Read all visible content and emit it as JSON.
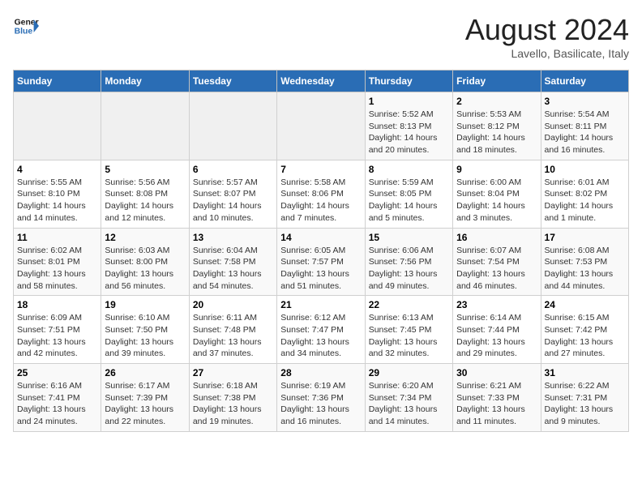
{
  "logo": {
    "text_general": "General",
    "text_blue": "Blue"
  },
  "title": "August 2024",
  "location": "Lavello, Basilicate, Italy",
  "days": [
    "Sunday",
    "Monday",
    "Tuesday",
    "Wednesday",
    "Thursday",
    "Friday",
    "Saturday"
  ],
  "weeks": [
    [
      {
        "day": "",
        "info": ""
      },
      {
        "day": "",
        "info": ""
      },
      {
        "day": "",
        "info": ""
      },
      {
        "day": "",
        "info": ""
      },
      {
        "day": "1",
        "info": "Sunrise: 5:52 AM\nSunset: 8:13 PM\nDaylight: 14 hours and 20 minutes."
      },
      {
        "day": "2",
        "info": "Sunrise: 5:53 AM\nSunset: 8:12 PM\nDaylight: 14 hours and 18 minutes."
      },
      {
        "day": "3",
        "info": "Sunrise: 5:54 AM\nSunset: 8:11 PM\nDaylight: 14 hours and 16 minutes."
      }
    ],
    [
      {
        "day": "4",
        "info": "Sunrise: 5:55 AM\nSunset: 8:10 PM\nDaylight: 14 hours and 14 minutes."
      },
      {
        "day": "5",
        "info": "Sunrise: 5:56 AM\nSunset: 8:08 PM\nDaylight: 14 hours and 12 minutes."
      },
      {
        "day": "6",
        "info": "Sunrise: 5:57 AM\nSunset: 8:07 PM\nDaylight: 14 hours and 10 minutes."
      },
      {
        "day": "7",
        "info": "Sunrise: 5:58 AM\nSunset: 8:06 PM\nDaylight: 14 hours and 7 minutes."
      },
      {
        "day": "8",
        "info": "Sunrise: 5:59 AM\nSunset: 8:05 PM\nDaylight: 14 hours and 5 minutes."
      },
      {
        "day": "9",
        "info": "Sunrise: 6:00 AM\nSunset: 8:04 PM\nDaylight: 14 hours and 3 minutes."
      },
      {
        "day": "10",
        "info": "Sunrise: 6:01 AM\nSunset: 8:02 PM\nDaylight: 14 hours and 1 minute."
      }
    ],
    [
      {
        "day": "11",
        "info": "Sunrise: 6:02 AM\nSunset: 8:01 PM\nDaylight: 13 hours and 58 minutes."
      },
      {
        "day": "12",
        "info": "Sunrise: 6:03 AM\nSunset: 8:00 PM\nDaylight: 13 hours and 56 minutes."
      },
      {
        "day": "13",
        "info": "Sunrise: 6:04 AM\nSunset: 7:58 PM\nDaylight: 13 hours and 54 minutes."
      },
      {
        "day": "14",
        "info": "Sunrise: 6:05 AM\nSunset: 7:57 PM\nDaylight: 13 hours and 51 minutes."
      },
      {
        "day": "15",
        "info": "Sunrise: 6:06 AM\nSunset: 7:56 PM\nDaylight: 13 hours and 49 minutes."
      },
      {
        "day": "16",
        "info": "Sunrise: 6:07 AM\nSunset: 7:54 PM\nDaylight: 13 hours and 46 minutes."
      },
      {
        "day": "17",
        "info": "Sunrise: 6:08 AM\nSunset: 7:53 PM\nDaylight: 13 hours and 44 minutes."
      }
    ],
    [
      {
        "day": "18",
        "info": "Sunrise: 6:09 AM\nSunset: 7:51 PM\nDaylight: 13 hours and 42 minutes."
      },
      {
        "day": "19",
        "info": "Sunrise: 6:10 AM\nSunset: 7:50 PM\nDaylight: 13 hours and 39 minutes."
      },
      {
        "day": "20",
        "info": "Sunrise: 6:11 AM\nSunset: 7:48 PM\nDaylight: 13 hours and 37 minutes."
      },
      {
        "day": "21",
        "info": "Sunrise: 6:12 AM\nSunset: 7:47 PM\nDaylight: 13 hours and 34 minutes."
      },
      {
        "day": "22",
        "info": "Sunrise: 6:13 AM\nSunset: 7:45 PM\nDaylight: 13 hours and 32 minutes."
      },
      {
        "day": "23",
        "info": "Sunrise: 6:14 AM\nSunset: 7:44 PM\nDaylight: 13 hours and 29 minutes."
      },
      {
        "day": "24",
        "info": "Sunrise: 6:15 AM\nSunset: 7:42 PM\nDaylight: 13 hours and 27 minutes."
      }
    ],
    [
      {
        "day": "25",
        "info": "Sunrise: 6:16 AM\nSunset: 7:41 PM\nDaylight: 13 hours and 24 minutes."
      },
      {
        "day": "26",
        "info": "Sunrise: 6:17 AM\nSunset: 7:39 PM\nDaylight: 13 hours and 22 minutes."
      },
      {
        "day": "27",
        "info": "Sunrise: 6:18 AM\nSunset: 7:38 PM\nDaylight: 13 hours and 19 minutes."
      },
      {
        "day": "28",
        "info": "Sunrise: 6:19 AM\nSunset: 7:36 PM\nDaylight: 13 hours and 16 minutes."
      },
      {
        "day": "29",
        "info": "Sunrise: 6:20 AM\nSunset: 7:34 PM\nDaylight: 13 hours and 14 minutes."
      },
      {
        "day": "30",
        "info": "Sunrise: 6:21 AM\nSunset: 7:33 PM\nDaylight: 13 hours and 11 minutes."
      },
      {
        "day": "31",
        "info": "Sunrise: 6:22 AM\nSunset: 7:31 PM\nDaylight: 13 hours and 9 minutes."
      }
    ]
  ]
}
